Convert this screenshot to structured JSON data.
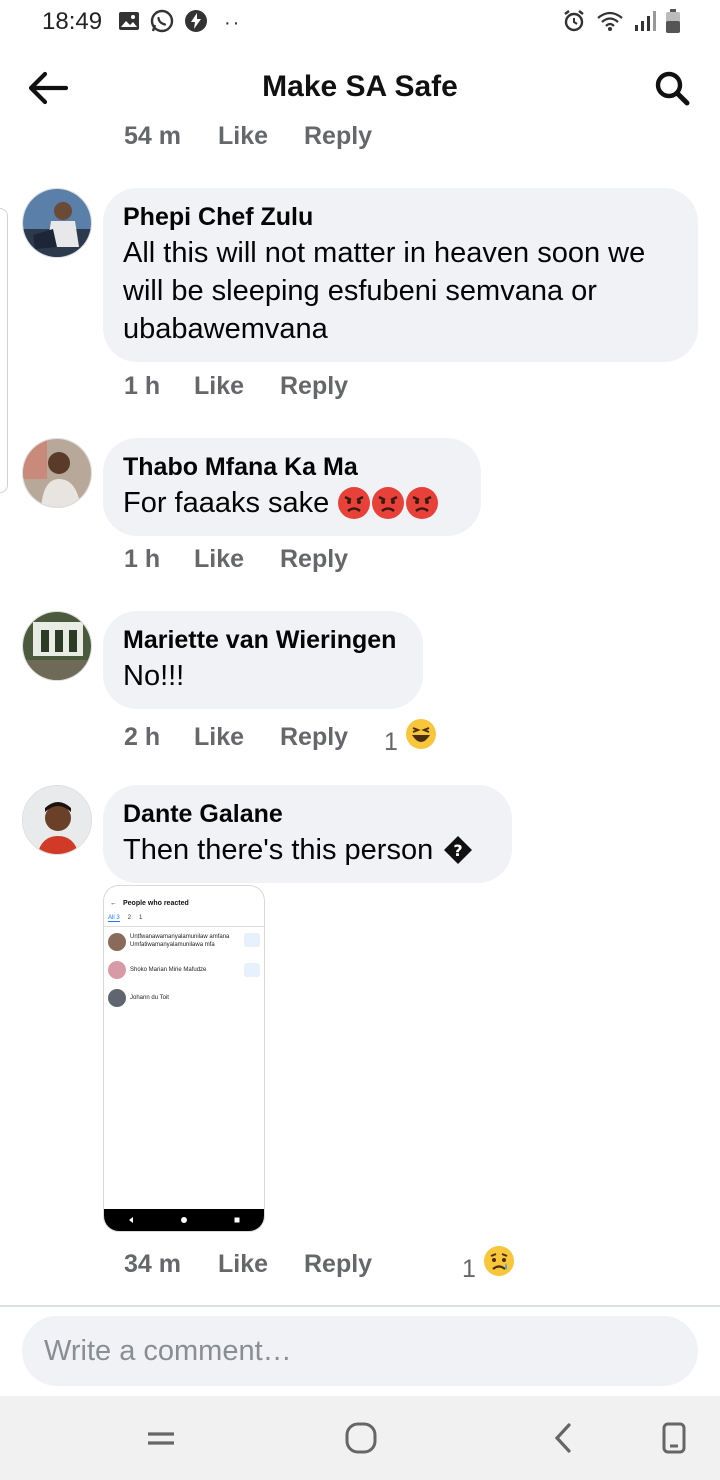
{
  "status_bar": {
    "time": "18:49",
    "left_icons": [
      "gallery-icon",
      "whatsapp-icon",
      "messenger-bolt-icon",
      "more-dots-icon"
    ],
    "right_icons": [
      "alarm-icon",
      "wifi-icon",
      "signal-icon",
      "battery-icon"
    ]
  },
  "header": {
    "title": "Make SA Safe",
    "back_icon": "arrow-left-icon",
    "search_icon": "search-icon"
  },
  "top_meta": {
    "time": "54 m",
    "like": "Like",
    "reply": "Reply"
  },
  "comments": [
    {
      "author": "Phepi Chef Zulu",
      "lines": [
        "All this will not matter in heaven soon we",
        "will be sleeping esfubeni semvana or",
        "ubabawemvana"
      ],
      "time": "1 h",
      "like": "Like",
      "reply": "Reply"
    },
    {
      "author": "Thabo Mfana Ka Ma",
      "text": "For faaaks sake",
      "emojis": [
        "angry-face",
        "angry-face",
        "angry-face"
      ],
      "time": "1 h",
      "like": "Like",
      "reply": "Reply"
    },
    {
      "author": "Mariette van Wieringen",
      "text": "No!!!",
      "time": "2 h",
      "like": "Like",
      "reply": "Reply",
      "reaction_count": "1",
      "reaction_icon": "haha-icon"
    },
    {
      "author": "Dante Galane",
      "text": "Then there's this person",
      "trailing_glyph": "unknown-char-icon",
      "time": "34 m",
      "like": "Like",
      "reply": "Reply",
      "reaction_count": "1",
      "reaction_icon": "sad-icon",
      "attachment": {
        "title": "People who reacted",
        "tabs": [
          "All 3",
          "2",
          "1"
        ],
        "people": [
          "Untfwanawamanyalamunilaw amfana Umfatiwamanyalamunilawa mfa",
          "Shoko Marian Mirie Mafudze",
          "Johann du Toit"
        ]
      }
    }
  ],
  "composer": {
    "placeholder": "Write a comment…"
  },
  "nav_bar": {
    "icons": [
      "recents-icon",
      "home-icon",
      "back-nav-icon",
      "screen-icon"
    ]
  }
}
